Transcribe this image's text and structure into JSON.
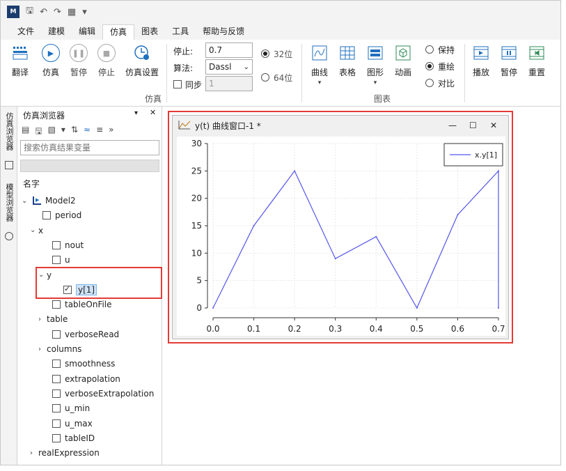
{
  "menu": {
    "tabs": [
      "文件",
      "建模",
      "编辑",
      "仿真",
      "图表",
      "工具",
      "帮助与反馈"
    ],
    "active": "仿真"
  },
  "ribbon": {
    "buttons": {
      "translate": "翻译",
      "simulate": "仿真",
      "pause": "暂停",
      "stop": "停止",
      "settings": "仿真设置"
    },
    "stop_label": "停止:",
    "stop_value": "0.7",
    "algo_label": "算法:",
    "algo_value": "Dassl",
    "sync_label": "同步",
    "sync_value": "1",
    "bit32": "32位",
    "bit64": "64位",
    "group_sim": "仿真",
    "chart_buttons": {
      "curve": "曲线",
      "table": "表格",
      "graphic": "图形",
      "anim": "动画"
    },
    "keep": "保持",
    "redraw": "重绘",
    "compare": "对比",
    "group_chart": "图表",
    "playback": {
      "play": "播放",
      "pause": "暂停",
      "reset": "重置"
    }
  },
  "side_tabs": {
    "sim": "仿真浏览器",
    "model": "模型浏览器"
  },
  "browser": {
    "title": "仿真浏览器",
    "search_placeholder": "搜索仿真结果变量",
    "col_name": "名字",
    "tree": [
      {
        "label": "Model2",
        "arrow": "⌄",
        "type": "model",
        "checked": false
      },
      {
        "label": "period",
        "type": "check",
        "checked": false
      },
      {
        "label": "x",
        "arrow": "⌄",
        "type": "folder",
        "checked": false
      },
      {
        "label": "nout",
        "type": "check",
        "checked": false
      },
      {
        "label": "u",
        "type": "check",
        "checked": false
      },
      {
        "label": "y",
        "arrow": "⌄",
        "type": "folder",
        "checked": false
      },
      {
        "label": "y[1]",
        "type": "check",
        "checked": true
      },
      {
        "label": "tableOnFile",
        "type": "check",
        "checked": false
      },
      {
        "label": "table",
        "arrow": "›",
        "type": "folder",
        "checked": false
      },
      {
        "label": "verboseRead",
        "type": "check",
        "checked": false
      },
      {
        "label": "columns",
        "arrow": "›",
        "type": "folder",
        "checked": false
      },
      {
        "label": "smoothness",
        "type": "check",
        "checked": false
      },
      {
        "label": "extrapolation",
        "type": "check",
        "checked": false
      },
      {
        "label": "verboseExtrapolation",
        "type": "check",
        "checked": false
      },
      {
        "label": "u_min",
        "type": "check",
        "checked": false
      },
      {
        "label": "u_max",
        "type": "check",
        "checked": false
      },
      {
        "label": "tableID",
        "type": "check",
        "checked": false
      },
      {
        "label": "realExpression",
        "arrow": "›",
        "type": "folder",
        "checked": false
      }
    ]
  },
  "plot_window": {
    "title": "y(t) 曲线窗口-1 *"
  },
  "chart_data": {
    "type": "line",
    "title": "",
    "xlabel": "",
    "ylabel": "",
    "xlim": [
      0.0,
      0.7
    ],
    "ylim": [
      0,
      30
    ],
    "x_ticks": [
      "0.0",
      "0.1",
      "0.2",
      "0.3",
      "0.4",
      "0.5",
      "0.6",
      "0.7"
    ],
    "y_ticks": [
      "0",
      "5",
      "10",
      "15",
      "20",
      "25",
      "30"
    ],
    "grid": true,
    "legend_position": "top-right",
    "series": [
      {
        "name": "x.y[1]",
        "color": "#5555ee",
        "x": [
          0.0,
          0.1,
          0.2,
          0.3,
          0.4,
          0.5,
          0.6,
          0.7,
          0.7
        ],
        "y": [
          0,
          15,
          25,
          9,
          13,
          0,
          17,
          25,
          0
        ]
      }
    ]
  }
}
